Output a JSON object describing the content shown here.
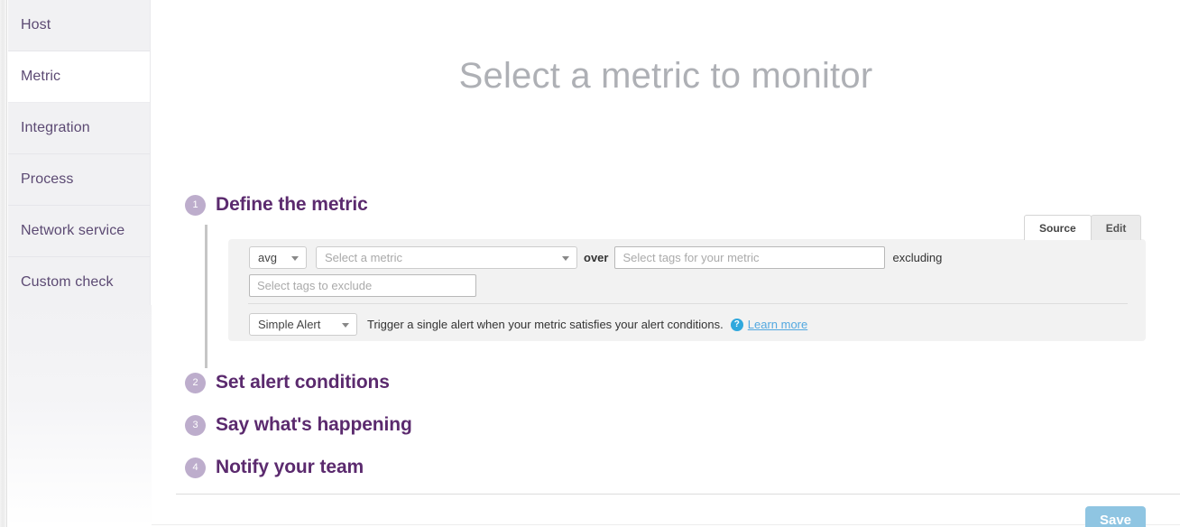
{
  "sidebar": {
    "items": [
      {
        "label": "Host",
        "selected": false
      },
      {
        "label": "Metric",
        "selected": true
      },
      {
        "label": "Integration",
        "selected": false
      },
      {
        "label": "Process",
        "selected": false
      },
      {
        "label": "Network service",
        "selected": false
      },
      {
        "label": "Custom check",
        "selected": false
      }
    ]
  },
  "main": {
    "page_title": "Select a metric to monitor",
    "steps": [
      {
        "num": "1",
        "title": "Define the metric"
      },
      {
        "num": "2",
        "title": "Set alert conditions"
      },
      {
        "num": "3",
        "title": "Say what's happening"
      },
      {
        "num": "4",
        "title": "Notify your team"
      }
    ],
    "tabs": [
      {
        "label": "Source",
        "active": true
      },
      {
        "label": "Edit",
        "active": false
      }
    ],
    "query": {
      "aggregation_value": "avg",
      "metric_placeholder": "Select a metric",
      "over_label": "over",
      "tags_placeholder": "Select tags for your metric",
      "excluding_label": "excluding",
      "exclude_tags_placeholder": "Select tags to exclude",
      "alert_type_value": "Simple Alert",
      "alert_description": "Trigger a single alert when your metric satisfies your alert conditions.",
      "help_icon": "question-mark-icon",
      "learn_more_label": "Learn more"
    },
    "footer": {
      "save_label": "Save"
    }
  },
  "colors": {
    "step_title": "#5b2a6e",
    "step_circle": "#bdadcc",
    "page_title": "#aeb0b5",
    "link": "#52a8e0",
    "help_badge": "#2fa8dd",
    "save_button": "#8fc5e2",
    "panel_bg": "#f2f2f2",
    "sidebar_item_bg": "#f1f1f3",
    "sidebar_text": "#5c4a73"
  }
}
